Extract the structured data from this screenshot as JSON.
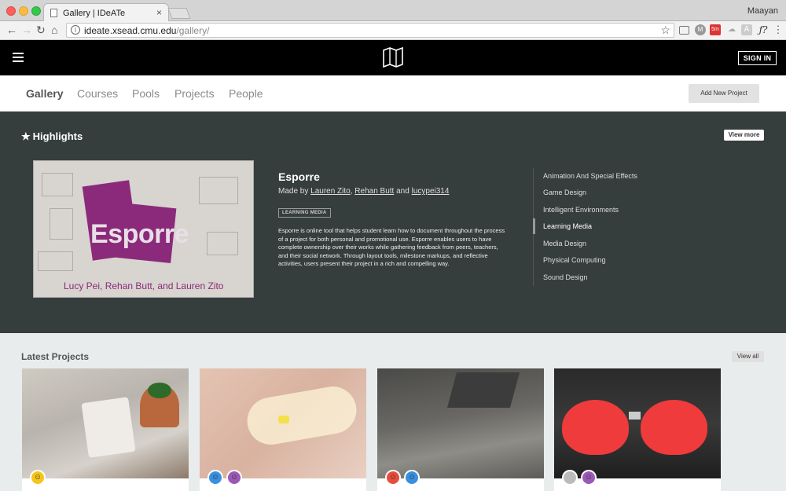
{
  "browser": {
    "tab_title": "Gallery | IDeATe",
    "tab_close": "×",
    "profile": "Maayan",
    "url_host": "ideate.xsead.cmu.edu",
    "url_path": "/gallery/",
    "info_glyph": "i",
    "back": "←",
    "forward": "→",
    "reload": "↻",
    "home": "⌂",
    "star": "☆",
    "ext_f": "ƒ?",
    "ext_a": "A",
    "ext_m": "M",
    "ext_tomato": "5m",
    "menu": "⋮"
  },
  "header": {
    "signin": "SIGN IN"
  },
  "subnav": {
    "items": [
      "Gallery",
      "Courses",
      "Pools",
      "Projects",
      "People"
    ],
    "add_project": "Add New Project"
  },
  "highlights": {
    "star": "★",
    "title": "Highlights",
    "view_more": "View more",
    "hero_brand_first": "E",
    "hero_brand_rest": "sporre",
    "hero_caption": "Lucy Pei, Rehan Butt, and Lauren Zito",
    "project_title": "Esporre",
    "made_by": "Made by",
    "author1": "Lauren Zito",
    "sep": ",",
    "author2": "Rehan Butt",
    "and": "and",
    "author3": "lucypei314",
    "tag": "LEARNING MEDIA",
    "description": "Esporre is online tool that helps student learn how to document throughout the process of a project for both personal and promotional use. Esporre enables users to have complete ownership over their works while gathering feedback from peers, teachers, and their social network. Through layout tools, milestone markups, and reflective activities, users present their project in a rich and compelling way.",
    "categories": [
      "Animation And Special Effects",
      "Game Design",
      "Intelligent Environments",
      "Learning Media",
      "Media Design",
      "Physical Computing",
      "Sound Design"
    ],
    "active_category": "Learning Media"
  },
  "latest": {
    "title": "Latest Projects",
    "view_all": "View all"
  },
  "colors": {
    "brand_purple": "#8b2a7a",
    "highlight_bg": "#363e3d"
  }
}
